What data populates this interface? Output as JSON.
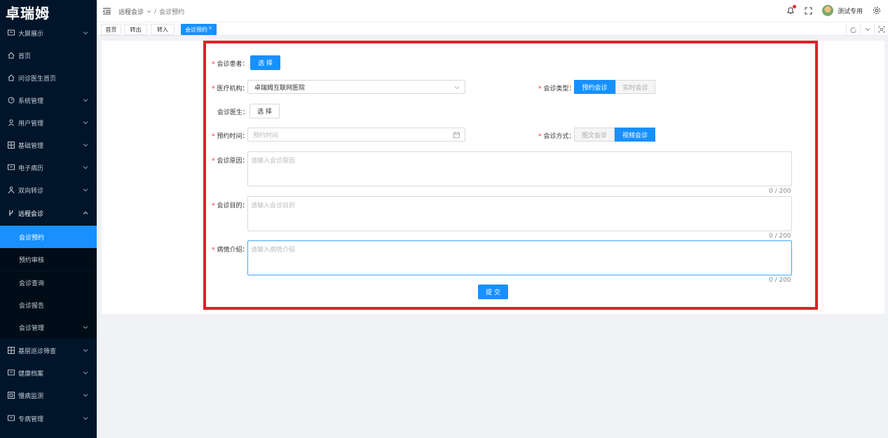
{
  "app": {
    "logo": "卓瑞姆"
  },
  "sidebar": {
    "items": [
      {
        "label": "大屏展示",
        "icon": "monitor-icon",
        "expandable": true
      },
      {
        "label": "首页",
        "icon": "home-icon",
        "expandable": false
      },
      {
        "label": "问诊医生首页",
        "icon": "home-icon",
        "expandable": false
      },
      {
        "label": "系统管理",
        "icon": "dashboard-icon",
        "expandable": true
      },
      {
        "label": "用户管理",
        "icon": "user-icon",
        "expandable": true
      },
      {
        "label": "基础管理",
        "icon": "grid-icon",
        "expandable": true
      },
      {
        "label": "电子病历",
        "icon": "monitor-icon",
        "expandable": true
      },
      {
        "label": "双向转诊",
        "icon": "people-icon",
        "expandable": true
      },
      {
        "label": "远程会诊",
        "icon": "branch-icon",
        "expandable": true,
        "expanded": true
      }
    ],
    "sub_items": [
      {
        "label": "会诊预约",
        "active": true
      },
      {
        "label": "预约审核"
      },
      {
        "label": "会诊查询"
      },
      {
        "label": "会诊报告"
      },
      {
        "label": "会诊管理",
        "expandable": true
      }
    ],
    "items_after": [
      {
        "label": "基层巡诊筛查",
        "icon": "grid-icon",
        "expandable": true
      },
      {
        "label": "健康档案",
        "icon": "monitor-icon",
        "expandable": true
      },
      {
        "label": "慢病监测",
        "icon": "square-icon",
        "expandable": true
      },
      {
        "label": "专病管理",
        "icon": "monitor-icon",
        "expandable": true
      }
    ]
  },
  "header": {
    "breadcrumb": [
      "远程会诊",
      "会诊预约"
    ],
    "user_name": "测试专用"
  },
  "tabs": [
    {
      "label": "首页"
    },
    {
      "label": "转出"
    },
    {
      "label": "转入"
    },
    {
      "label": "会诊预约",
      "active": true,
      "close": "×"
    }
  ],
  "form": {
    "patient": {
      "label": "会诊患者：",
      "button": "选 择"
    },
    "institution": {
      "label": "医疗机构：",
      "value": "卓瑞姆互联网医院"
    },
    "type": {
      "label": "会诊类型：",
      "options": [
        "预约会诊",
        "实时会诊"
      ],
      "selected": "预约会诊"
    },
    "doctor": {
      "label": "会诊医生：",
      "button": "选 择"
    },
    "time": {
      "label": "预约时间：",
      "placeholder": "预约时间"
    },
    "method": {
      "label": "会诊方式：",
      "options": [
        "图文会诊",
        "视频会诊"
      ],
      "selected": "视频会诊"
    },
    "reason": {
      "label": "会诊原因：",
      "placeholder": "请输入会诊原因",
      "count": "0 / 200"
    },
    "purpose": {
      "label": "会诊目的：",
      "placeholder": "请输入会诊目的",
      "count": "0 / 200"
    },
    "condition": {
      "label": "病情介绍：",
      "placeholder": "请输入病情介绍",
      "count": "0 / 200"
    },
    "submit": "提 交"
  },
  "colors": {
    "sidebar_bg": "#001529",
    "accent": "#1890ff",
    "required": "#f5222d",
    "highlight_border": "#e0202a"
  }
}
